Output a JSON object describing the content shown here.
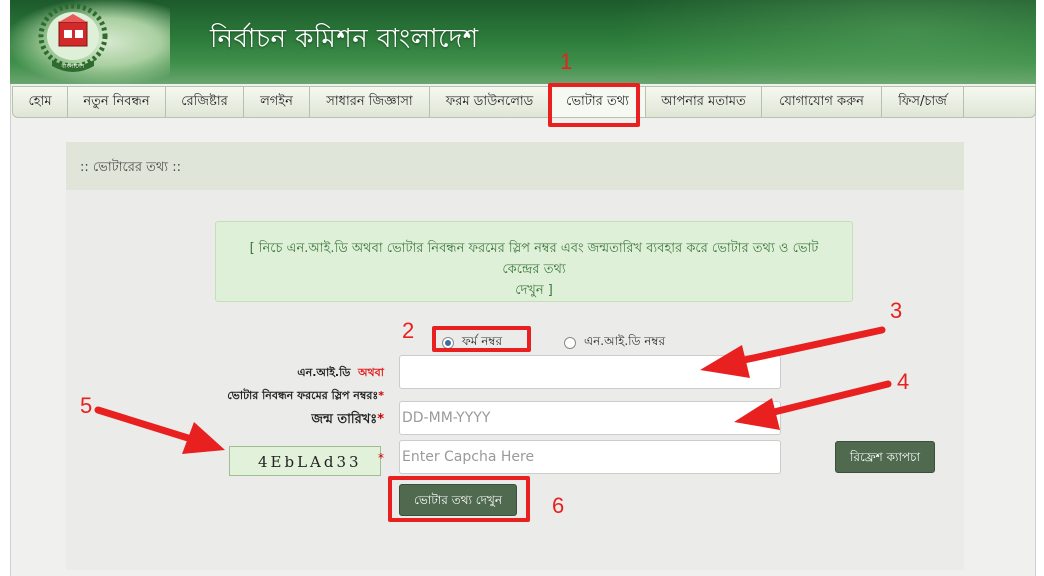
{
  "header": {
    "title": "নির্বাচন কমিশন বাংলাদেশ",
    "logo_text": "বাংলাদেশ",
    "brand_color": "#2c7a3a"
  },
  "nav": {
    "items": [
      {
        "label": "হোম"
      },
      {
        "label": "নতুন নিবন্ধন"
      },
      {
        "label": "রেজিষ্টার"
      },
      {
        "label": "লগইন"
      },
      {
        "label": "সাধারন জিজ্ঞাসা"
      },
      {
        "label": "ফরম ডাউনলোড"
      },
      {
        "label": "ভোটার তথ্য",
        "active": true
      },
      {
        "label": "আপনার মতামত"
      },
      {
        "label": "যোগাযোগ করুন"
      },
      {
        "label": "ফিস/চার্জ"
      }
    ]
  },
  "panel": {
    "title": ":: ভোটারের তথ্য ::",
    "info_line1": "[ নিচে এন.আই.ডি অথবা ভোটার নিবন্ধন ফরমের স্লিপ নম্বর এবং জন্মতারিখ ব্যবহার করে ভোটার তথ্য ও ভোট কেন্দ্রের তথ্য",
    "info_line2": "দেখুন ]"
  },
  "form": {
    "radio_form_label": "ফর্ম নম্বর",
    "radio_nid_label": "এন.আই.ডি নম্বর",
    "selected": "ফর্ম নম্বর",
    "id_label_part1": "এন.আই.ডি",
    "id_label_or": "অথবা",
    "id_label_line2": "ভোটার নিবন্ধন ফরমের স্লিপ নম্বরঃ",
    "id_value": "",
    "dob_label": "জন্ম তারিখঃ",
    "dob_placeholder": "DD-MM-YYYY",
    "captcha_text": "4EbLAd33",
    "captcha_placeholder": "Enter Capcha Here",
    "required_mark": "*",
    "refresh_button": "রিফ্রেশ ক্যাপচা",
    "submit_button": "ভোটার তথ্য দেখুন"
  },
  "annotations": {
    "n1": "1",
    "n2": "2",
    "n3": "3",
    "n4": "4",
    "n5": "5",
    "n6": "6",
    "color": "#e82020"
  }
}
